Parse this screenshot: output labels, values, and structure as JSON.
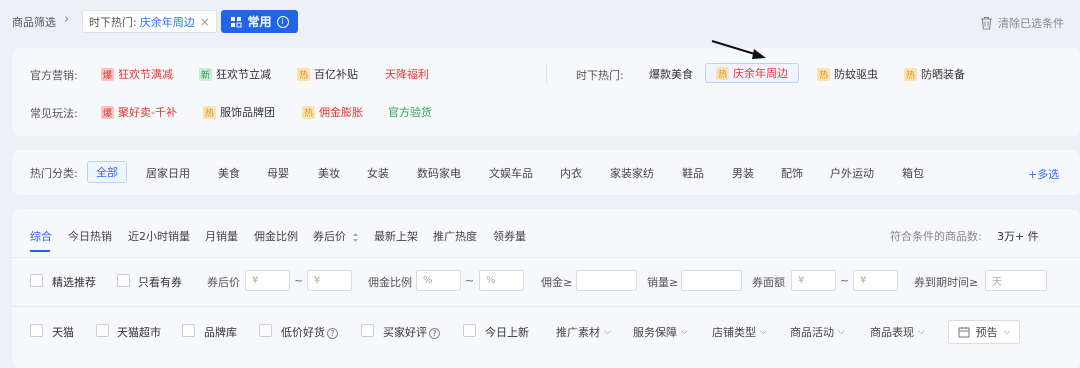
{
  "header": {
    "breadcrumb": "商品筛选",
    "chip_label": "时下热门:",
    "chip_value": "庆余年周边",
    "chip_close": "×",
    "common_button": "常用",
    "clear_all": "清除已选条件"
  },
  "marketing": {
    "label": "官方营销:",
    "items": [
      {
        "badge": "爆",
        "text": "狂欢节满减"
      },
      {
        "badge": "新",
        "text": "狂欢节立减"
      },
      {
        "badge": "热",
        "text": "百亿补贴"
      },
      {
        "text": "天降福利"
      }
    ]
  },
  "trending": {
    "label": "时下热门:",
    "items": [
      {
        "text": "爆款美食"
      },
      {
        "badge": "热",
        "text": "庆余年周边"
      },
      {
        "badge": "热",
        "text": "防蚊驱虫"
      },
      {
        "badge": "热",
        "text": "防晒装备"
      }
    ]
  },
  "gameplay": {
    "label": "常见玩法:",
    "items": [
      {
        "badge": "爆",
        "text": "聚好卖-千补"
      },
      {
        "badge": "热",
        "text": "服饰品牌团"
      },
      {
        "badge": "热",
        "text": "佣金膨胀"
      },
      {
        "text": "官方验货"
      }
    ]
  },
  "categories": {
    "label": "热门分类:",
    "items": [
      "全部",
      "居家日用",
      "美食",
      "母婴",
      "美妆",
      "女装",
      "数码家电",
      "文娱车品",
      "内衣",
      "家装家纺",
      "鞋品",
      "男装",
      "配饰",
      "户外运动",
      "箱包"
    ],
    "multi": "+多选"
  },
  "sort": {
    "items": [
      "综合",
      "今日热销",
      "近2小时销量",
      "月销量",
      "佣金比例",
      "券后价",
      "最新上架",
      "推广热度",
      "领券量"
    ],
    "result_label": "符合条件的商品数:",
    "result_value": "3万+ 件"
  },
  "filters_row1": {
    "featured": "精选推荐",
    "coupon_only": "只看有券",
    "price_label": "券后价",
    "currency": "¥",
    "commission_rate_label": "佣金比例",
    "percent": "%",
    "commission_label": "佣金≥",
    "sales_label": "销量≥",
    "coupon_value_label": "券面额",
    "expire_label": "券到期时间≥",
    "day": "天",
    "tilde": "~"
  },
  "filters_row2": {
    "tmall": "天猫",
    "tmall_super": "天猫超市",
    "brand": "品牌库",
    "low_price": "低价好货",
    "good_review": "买家好评",
    "today_new": "今日上新",
    "dropdowns": [
      "推广素材",
      "服务保障",
      "店铺类型",
      "商品活动",
      "商品表现"
    ],
    "preview": "预告"
  },
  "colors": {
    "accent": "#2164e8",
    "hot_red": "#e53935",
    "green": "#2aa55a"
  }
}
